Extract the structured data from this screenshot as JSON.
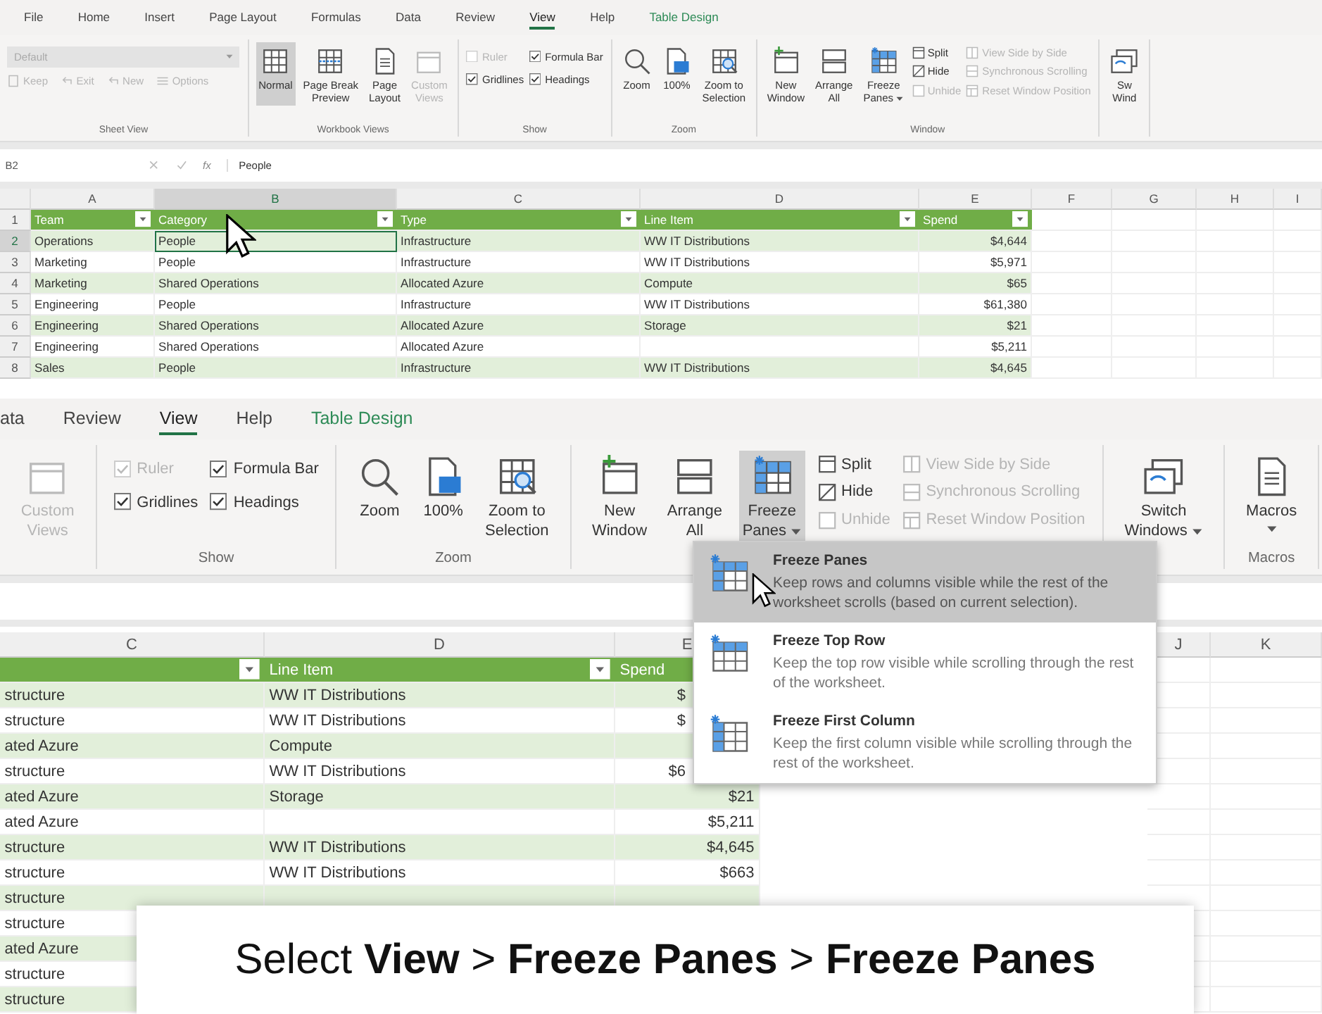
{
  "panels": [
    {
      "kind": "overview",
      "tabs": [
        {
          "label": "File",
          "selected": false,
          "contextual": false
        },
        {
          "label": "Home",
          "selected": false,
          "contextual": false
        },
        {
          "label": "Insert",
          "selected": false,
          "contextual": false
        },
        {
          "label": "Page Layout",
          "selected": false,
          "contextual": false
        },
        {
          "label": "Formulas",
          "selected": false,
          "contextual": false
        },
        {
          "label": "Data",
          "selected": false,
          "contextual": false
        },
        {
          "label": "Review",
          "selected": false,
          "contextual": false
        },
        {
          "label": "View",
          "selected": true,
          "contextual": false
        },
        {
          "label": "Help",
          "selected": false,
          "contextual": false
        },
        {
          "label": "Table Design",
          "selected": false,
          "contextual": true
        }
      ],
      "ribbon": [
        {
          "label": "Sheet View",
          "items": [
            {
              "kind": "stack",
              "items": [
                {
                  "kind": "combo",
                  "value": "Default",
                  "disabled": true
                },
                {
                  "kind": "row",
                  "items": [
                    {
                      "kind": "keep",
                      "label": "Keep",
                      "disabled": true
                    },
                    {
                      "kind": "exit",
                      "label": "Exit",
                      "disabled": true
                    },
                    {
                      "kind": "new",
                      "label": "New",
                      "disabled": true
                    },
                    {
                      "kind": "options",
                      "label": "Options",
                      "disabled": true
                    }
                  ]
                }
              ]
            }
          ]
        },
        {
          "label": "Workbook Views",
          "items": [
            {
              "kind": "normal",
              "lines": [
                "Normal"
              ],
              "selected": true,
              "disabled": false,
              "dropdown": false
            },
            {
              "kind": "page_break",
              "lines": [
                "Page Break",
                "Preview"
              ],
              "selected": false,
              "disabled": false,
              "dropdown": false
            },
            {
              "kind": "page_layout",
              "lines": [
                "Page",
                "Layout"
              ],
              "selected": false,
              "disabled": false,
              "dropdown": false
            },
            {
              "kind": "custom_views",
              "lines": [
                "Custom",
                "Views"
              ],
              "selected": false,
              "disabled": true,
              "dropdown": false
            }
          ]
        },
        {
          "label": "Show",
          "items": [
            {
              "kind": "stack",
              "items": [
                {
                  "kind": "check",
                  "label": "Ruler",
                  "checked": false,
                  "disabled": true
                },
                {
                  "kind": "check",
                  "label": "Gridlines",
                  "checked": true,
                  "disabled": false
                }
              ]
            },
            {
              "kind": "stack",
              "items": [
                {
                  "kind": "check",
                  "label": "Formula Bar",
                  "checked": true,
                  "disabled": false
                },
                {
                  "kind": "check",
                  "label": "Headings",
                  "checked": true,
                  "disabled": false
                }
              ]
            }
          ]
        },
        {
          "label": "Zoom",
          "items": [
            {
              "kind": "zoom",
              "lines": [
                "Zoom"
              ],
              "selected": false,
              "disabled": false,
              "dropdown": false
            },
            {
              "kind": "hundred",
              "lines": [
                "100%"
              ],
              "selected": false,
              "disabled": false,
              "dropdown": false
            },
            {
              "kind": "zoom_selection",
              "lines": [
                "Zoom to",
                "Selection"
              ],
              "selected": false,
              "disabled": false,
              "dropdown": false
            }
          ]
        },
        {
          "label": "Window",
          "items": [
            {
              "kind": "new_window",
              "lines": [
                "New",
                "Window"
              ],
              "selected": false,
              "disabled": false,
              "dropdown": false
            },
            {
              "kind": "arrange",
              "lines": [
                "Arrange",
                "All"
              ],
              "selected": false,
              "disabled": false,
              "dropdown": false
            },
            {
              "kind": "freeze",
              "lines": [
                "Freeze",
                "Panes"
              ],
              "selected": false,
              "disabled": false,
              "dropdown": true
            },
            {
              "kind": "stack",
              "items": [
                {
                  "kind": "split",
                  "label": "Split",
                  "disabled": false
                },
                {
                  "kind": "hide",
                  "label": "Hide",
                  "disabled": false
                },
                {
                  "kind": "unhide",
                  "label": "Unhide",
                  "disabled": true
                }
              ]
            },
            {
              "kind": "stack",
              "items": [
                {
                  "kind": "side_by_side",
                  "label": "View Side by Side",
                  "disabled": true
                },
                {
                  "kind": "sync",
                  "label": "Synchronous Scrolling",
                  "disabled": true
                },
                {
                  "kind": "reset",
                  "label": "Reset Window Position",
                  "disabled": true
                }
              ]
            }
          ]
        },
        {
          "items": [
            {
              "kind": "switch",
              "lines": [
                "Sw",
                "Wind"
              ],
              "selected": false,
              "disabled": false,
              "dropdown": false
            }
          ]
        }
      ],
      "formula_bar": {
        "name_box": "B2",
        "function_label": "fx",
        "formula": "People"
      },
      "sheet": {
        "columns": [
          {
            "label": "A",
            "selected": false
          },
          {
            "label": "B",
            "selected": true
          },
          {
            "label": "C",
            "selected": false
          },
          {
            "label": "D",
            "selected": false
          },
          {
            "label": "E",
            "selected": false
          },
          {
            "label": "F",
            "selected": false
          },
          {
            "label": "G",
            "selected": false
          },
          {
            "label": "H",
            "selected": false
          },
          {
            "label": "I",
            "selected": false
          }
        ],
        "rows": [
          {
            "number": "1",
            "kind": "header",
            "selected": false,
            "cells": [
              "Team",
              "Category",
              "Type",
              "Line Item",
              "Spend"
            ]
          },
          {
            "number": "2",
            "kind": "data",
            "selected": true,
            "cells": [
              "Operations",
              "People",
              "Infrastructure",
              "WW IT Distributions",
              "$4,644"
            ]
          },
          {
            "number": "3",
            "kind": "data",
            "selected": false,
            "cells": [
              "Marketing",
              "People",
              "Infrastructure",
              "WW IT Distributions",
              "$5,971"
            ]
          },
          {
            "number": "4",
            "kind": "data",
            "selected": false,
            "cells": [
              "Marketing",
              "Shared Operations",
              "Allocated Azure",
              "Compute",
              "$65"
            ]
          },
          {
            "number": "5",
            "kind": "data",
            "selected": false,
            "cells": [
              "Engineering",
              "People",
              "Infrastructure",
              "WW IT Distributions",
              "$61,380"
            ]
          },
          {
            "number": "6",
            "kind": "data",
            "selected": false,
            "cells": [
              "Engineering",
              "Shared Operations",
              "Allocated Azure",
              "Storage",
              "$21"
            ]
          },
          {
            "number": "7",
            "kind": "data",
            "selected": false,
            "cells": [
              "Engineering",
              "Shared Operations",
              "Allocated Azure",
              null,
              "$5,211"
            ]
          },
          {
            "number": "8",
            "kind": "data",
            "selected": false,
            "cells": [
              "Sales",
              "People",
              "Infrastructure",
              "WW IT Distributions",
              "$4,645"
            ]
          }
        ]
      }
    },
    {
      "kind": "closeup",
      "tabs": [
        {
          "label": "ata",
          "selected": false,
          "contextual": false
        },
        {
          "label": "Review",
          "selected": false,
          "contextual": false
        },
        {
          "label": "View",
          "selected": true,
          "contextual": false
        },
        {
          "label": "Help",
          "selected": false,
          "contextual": false
        },
        {
          "label": "Table Design",
          "selected": false,
          "contextual": true
        }
      ],
      "ribbon": [
        {
          "items": [
            {
              "kind": "custom_views",
              "lines": [
                "Custom",
                "Views"
              ],
              "selected": false,
              "disabled": true,
              "dropdown": false
            }
          ]
        },
        {
          "label": "Show",
          "items": [
            {
              "kind": "stack",
              "items": [
                {
                  "kind": "check",
                  "label": "Ruler",
                  "checked": true,
                  "disabled": true
                },
                {
                  "kind": "check",
                  "label": "Gridlines",
                  "checked": true,
                  "disabled": false
                }
              ]
            },
            {
              "kind": "stack",
              "items": [
                {
                  "kind": "check",
                  "label": "Formula Bar",
                  "checked": true,
                  "disabled": false
                },
                {
                  "kind": "check",
                  "label": "Headings",
                  "checked": true,
                  "disabled": false
                }
              ]
            }
          ]
        },
        {
          "label": "Zoom",
          "items": [
            {
              "kind": "zoom",
              "lines": [
                "Zoom"
              ],
              "selected": false,
              "disabled": false,
              "dropdown": false
            },
            {
              "kind": "hundred",
              "lines": [
                "100%"
              ],
              "selected": false,
              "disabled": false,
              "dropdown": false
            },
            {
              "kind": "zoom_selection",
              "lines": [
                "Zoom to",
                "Selection"
              ],
              "selected": false,
              "disabled": false,
              "dropdown": false
            }
          ]
        },
        {
          "items": [
            {
              "kind": "new_window",
              "lines": [
                "New",
                "Window"
              ],
              "selected": false,
              "disabled": false,
              "dropdown": false
            },
            {
              "kind": "arrange",
              "lines": [
                "Arrange",
                "All"
              ],
              "selected": false,
              "disabled": false,
              "dropdown": false
            },
            {
              "kind": "freeze",
              "lines": [
                "Freeze",
                "Panes"
              ],
              "selected": true,
              "disabled": false,
              "dropdown": true
            },
            {
              "kind": "stack",
              "items": [
                {
                  "kind": "split",
                  "label": "Split",
                  "disabled": false
                },
                {
                  "kind": "hide",
                  "label": "Hide",
                  "disabled": false
                },
                {
                  "kind": "unhide",
                  "label": "Unhide",
                  "disabled": true
                }
              ]
            },
            {
              "kind": "stack",
              "items": [
                {
                  "kind": "side_by_side",
                  "label": "View Side by Side",
                  "disabled": true
                },
                {
                  "kind": "sync",
                  "label": "Synchronous Scrolling",
                  "disabled": true
                },
                {
                  "kind": "reset",
                  "label": "Reset Window Position",
                  "disabled": true
                }
              ]
            }
          ]
        },
        {
          "items": [
            {
              "kind": "switch",
              "lines": [
                "Switch",
                "Windows"
              ],
              "selected": false,
              "disabled": false,
              "dropdown": true
            }
          ]
        },
        {
          "label": "Macros",
          "items": [
            {
              "kind": "macros",
              "lines": [
                "Macros"
              ],
              "selected": false,
              "disabled": false,
              "dropdown": true
            }
          ]
        }
      ],
      "sheet": {
        "columns": [
          {
            "label": "C",
            "selected": false
          },
          {
            "label": "D",
            "selected": false
          },
          {
            "label": "E",
            "selected": false
          },
          {
            "label": "J",
            "selected": false
          },
          {
            "label": "K",
            "selected": false
          }
        ],
        "rows": [
          {
            "kind": "header",
            "clipped": true,
            "cells": [
              null,
              "Line Item",
              "Spend"
            ]
          },
          {
            "kind": "data",
            "clipped": true,
            "cells": [
              "structure",
              "WW IT Distributions",
              "$"
            ]
          },
          {
            "kind": "data",
            "clipped": true,
            "cells": [
              "structure",
              "WW IT Distributions",
              "$"
            ]
          },
          {
            "kind": "data",
            "cells": [
              "ated Azure",
              "Compute",
              null
            ]
          },
          {
            "kind": "data",
            "clipped": true,
            "cells": [
              "structure",
              "WW IT Distributions",
              "$6"
            ]
          },
          {
            "kind": "data",
            "cells": [
              "ated Azure",
              "Storage",
              "$21"
            ]
          },
          {
            "kind": "data",
            "cells": [
              "ated Azure",
              null,
              "$5,211"
            ]
          },
          {
            "kind": "data",
            "cells": [
              "structure",
              "WW IT Distributions",
              "$4,645"
            ]
          },
          {
            "kind": "data",
            "cells": [
              "structure",
              "WW IT Distributions",
              "$663"
            ]
          },
          {
            "kind": "data",
            "cells": [
              "structure",
              null,
              null
            ]
          },
          {
            "kind": "data",
            "cells": [
              "structure",
              null,
              null
            ]
          },
          {
            "kind": "data",
            "cells": [
              "ated Azure",
              null,
              null
            ]
          },
          {
            "kind": "data",
            "cells": [
              "structure",
              null,
              null
            ]
          },
          {
            "kind": "data",
            "cells": [
              "structure",
              null,
              null
            ]
          }
        ]
      }
    }
  ],
  "freeze_menu": {
    "items": [
      {
        "kind": "panes",
        "title": "Freeze Panes",
        "description": "Keep rows and columns visible while the rest of the worksheet scrolls (based on current selection).",
        "selected": true
      },
      {
        "kind": "top_row",
        "title": "Freeze Top Row",
        "description": "Keep the top row visible while scrolling through the rest of the worksheet.",
        "selected": false
      },
      {
        "kind": "first_column",
        "title": "Freeze First Column",
        "description": "Keep the first column visible while scrolling through the rest of the worksheet.",
        "selected": false
      }
    ]
  },
  "caption": {
    "text": "Select **View** > **Freeze Panes** > **Freeze Panes**"
  }
}
